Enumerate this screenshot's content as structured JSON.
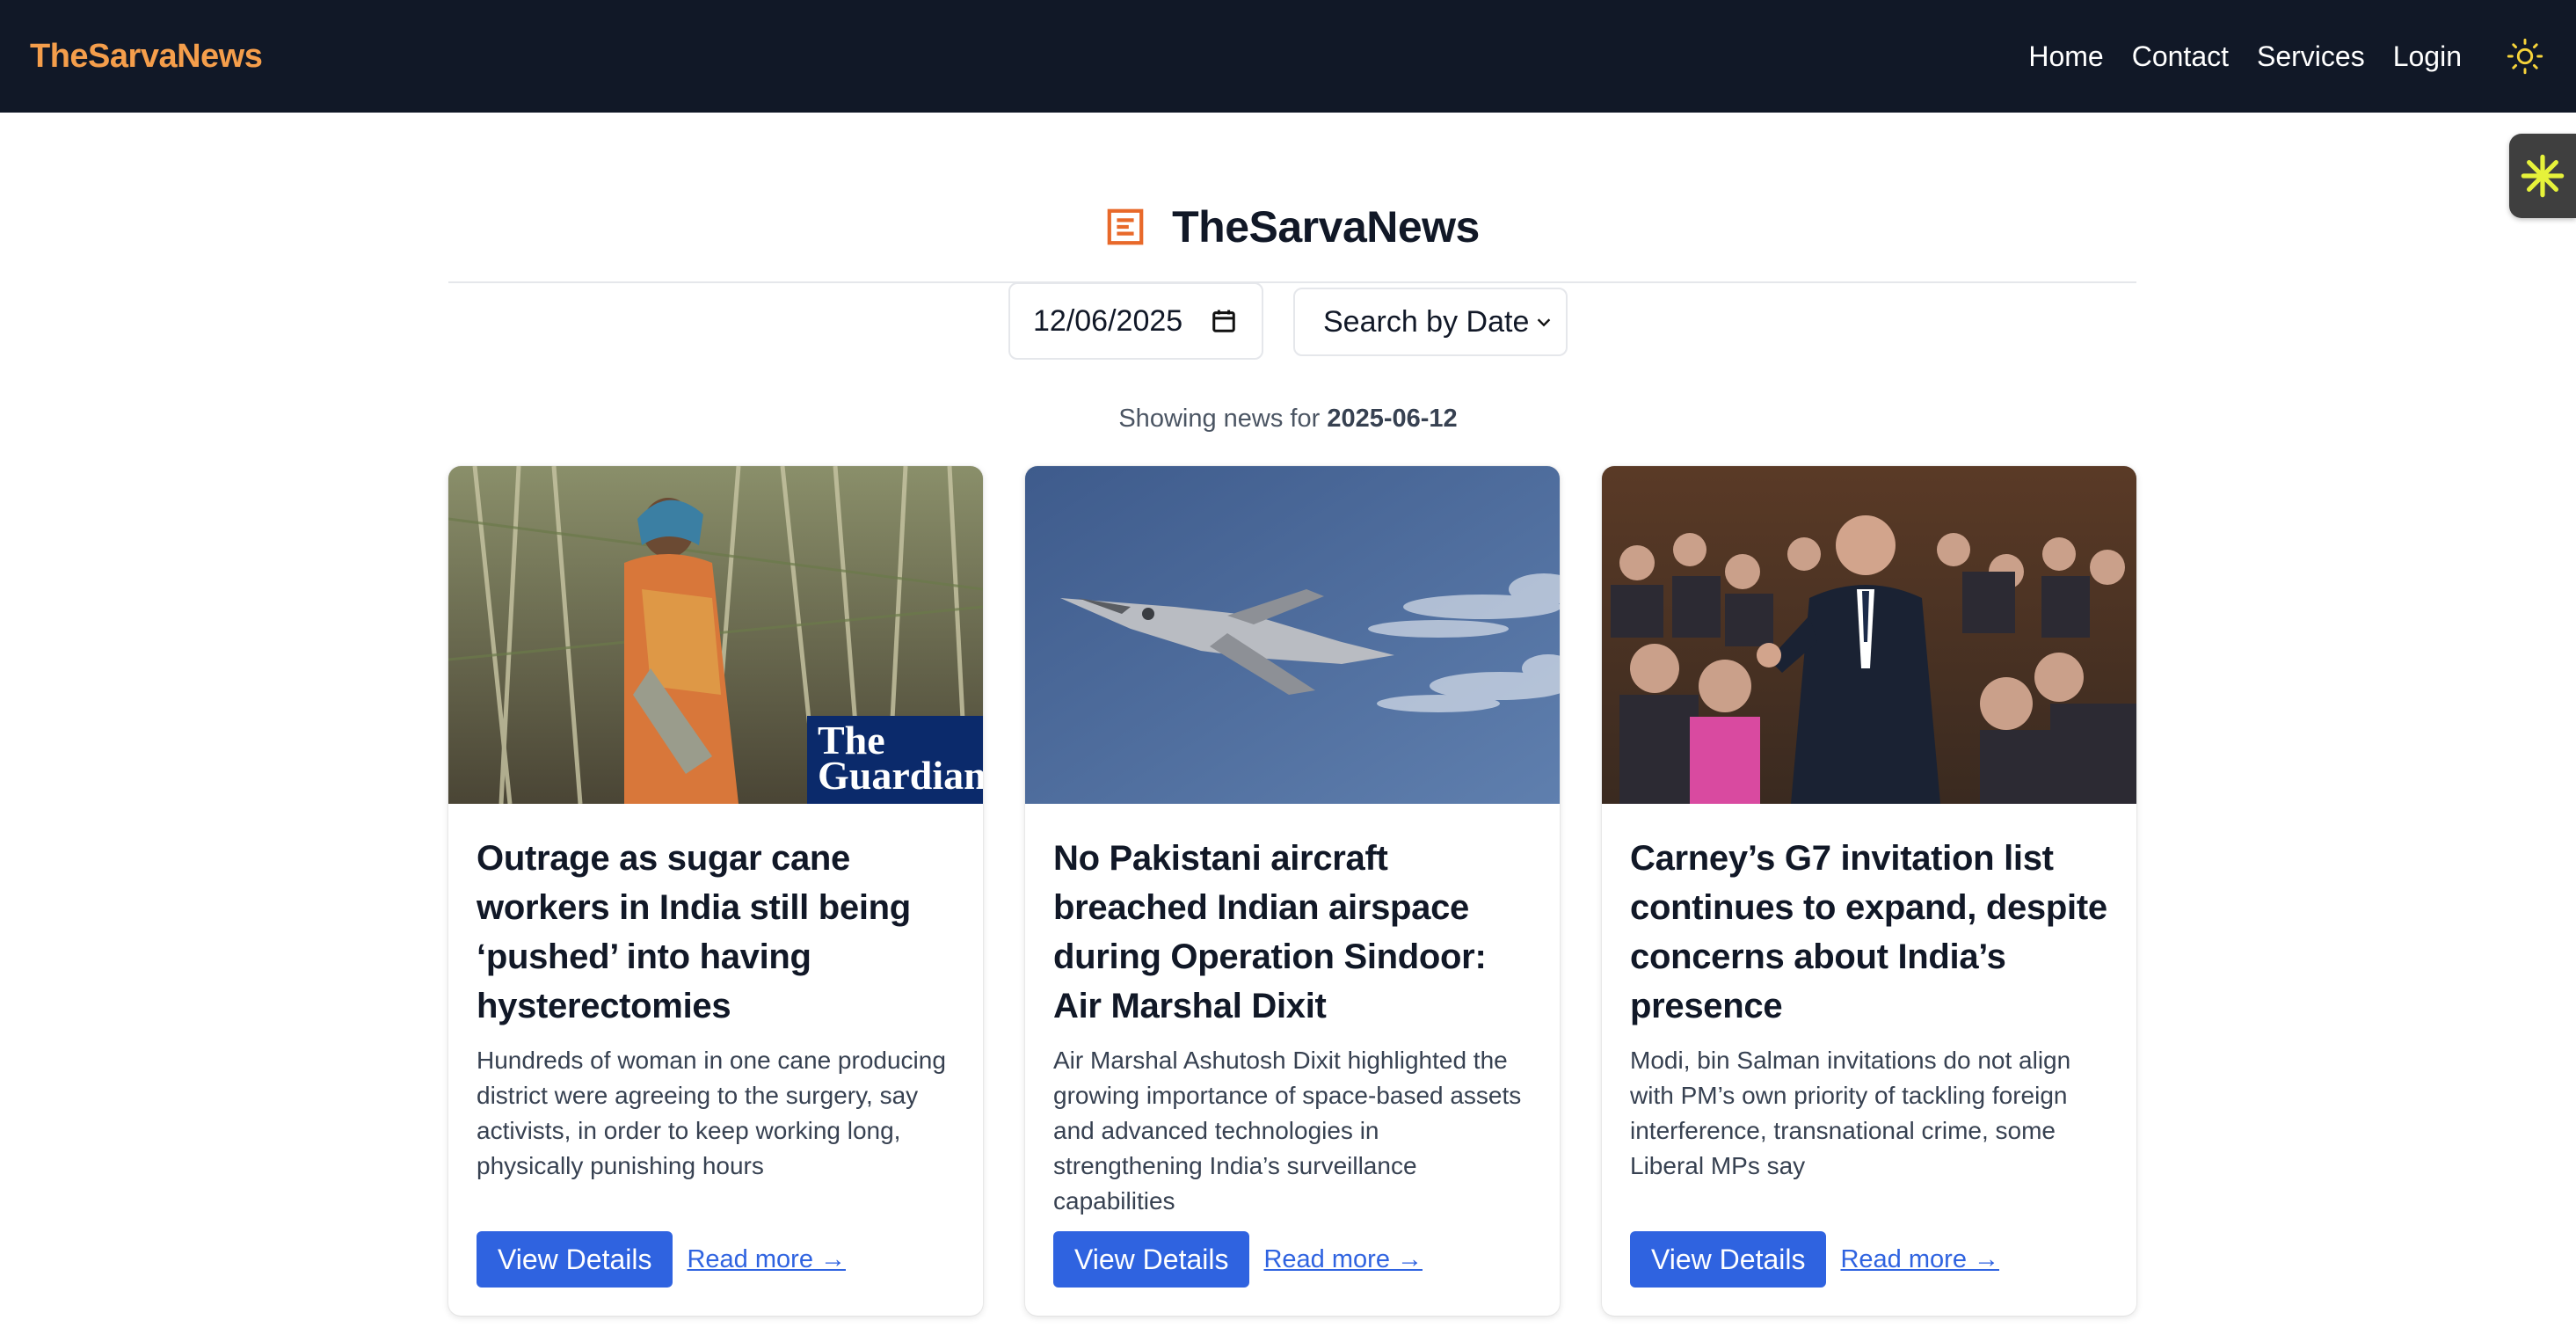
{
  "navbar": {
    "brand": "TheSarvaNews",
    "links": [
      "Home",
      "Contact",
      "Services",
      "Login"
    ]
  },
  "header": {
    "title": "TheSarvaNews"
  },
  "filters": {
    "date_value": "12/06/2025",
    "search_mode": "Search by Date"
  },
  "status": {
    "prefix": "Showing news for ",
    "date": "2025-06-12"
  },
  "articles": [
    {
      "title": "Outrage as sugar cane workers in India still being ‘pushed’ into having hysterectomies",
      "description": "Hundreds of woman in one cane producing district were agreeing to the surgery, say activists, in order to keep working long, physically punishing hours",
      "image_watermark": "The Guardian",
      "details_label": "View Details",
      "read_more_label": "Read more →"
    },
    {
      "title": "No Pakistani aircraft breached Indian airspace during Operation Sindoor: Air Marshal Dixit",
      "description": "Air Marshal Ashutosh Dixit highlighted the growing importance of space-based assets and advanced technologies in strengthening India’s surveillance capabilities",
      "details_label": "View Details",
      "read_more_label": "Read more →"
    },
    {
      "title": "Carney’s G7 invitation list continues to expand, despite concerns about India’s presence",
      "description": "Modi, bin Salman invitations do not align with PM’s own priority of tackling foreign interference, transnational crime, some Liberal MPs say",
      "details_label": "View Details",
      "read_more_label": "Read more →"
    }
  ],
  "colors": {
    "topbar_bg": "#111827",
    "brand": "#f59e4b",
    "accent": "#2f63e0",
    "logo_icon": "#e8692a"
  }
}
